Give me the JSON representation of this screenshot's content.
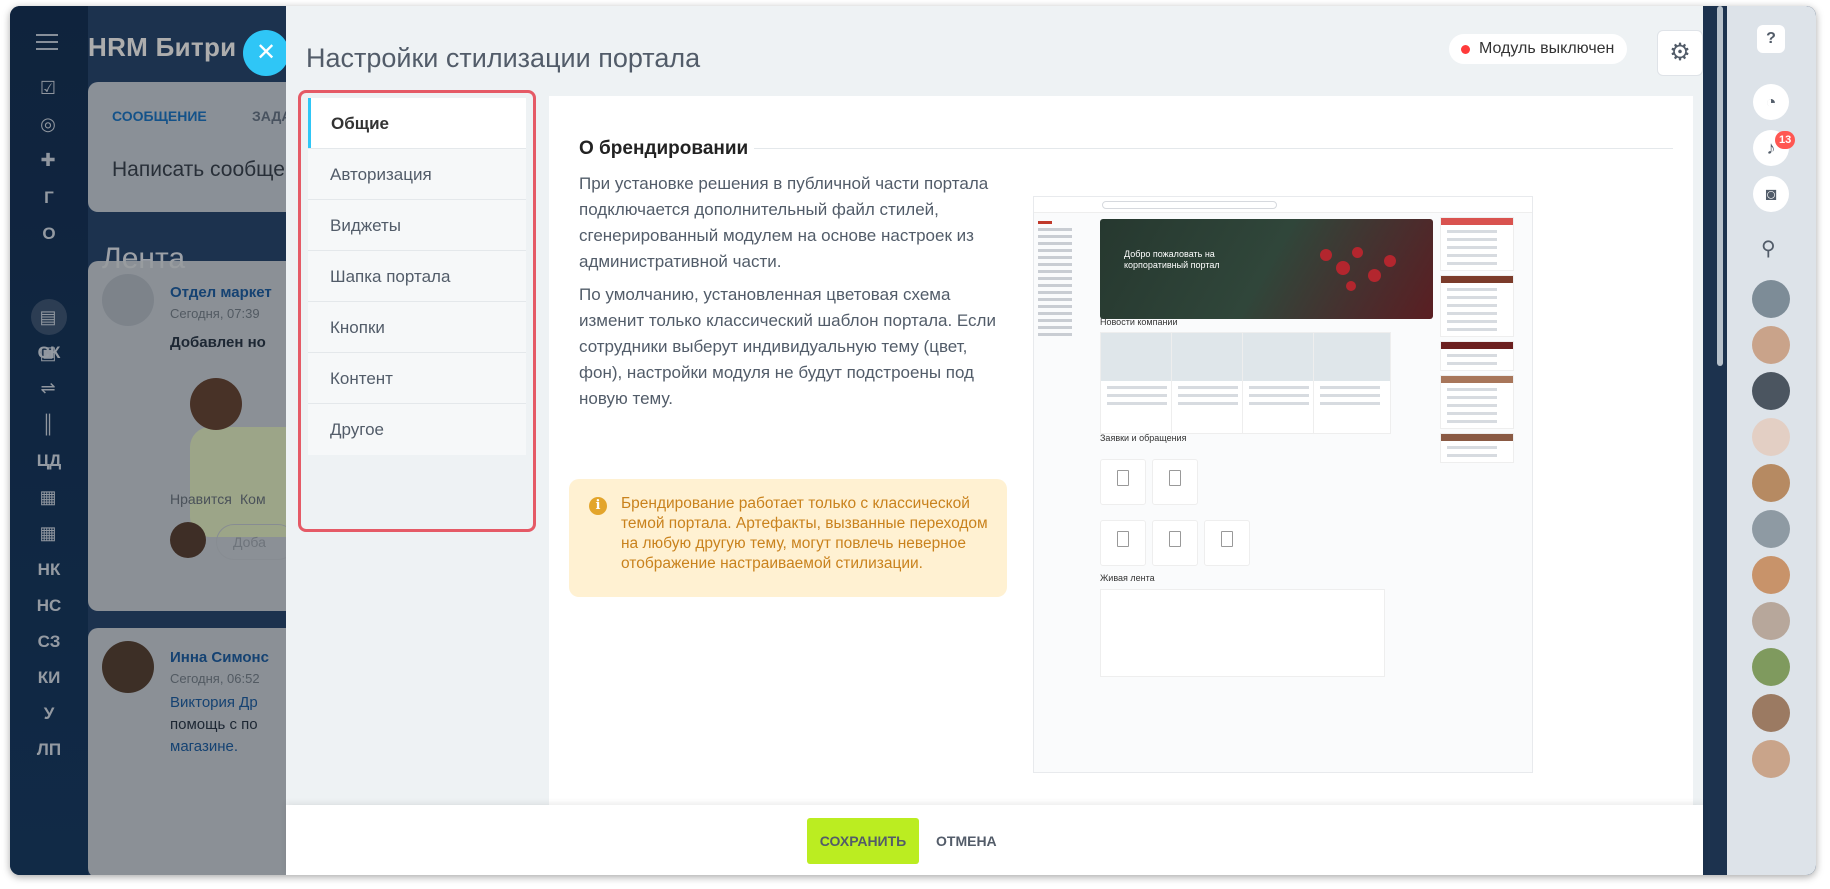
{
  "app": {
    "title": "HRM Битри"
  },
  "left_rail": {
    "items": [
      "Г",
      "О",
      "СК",
      "ЦД",
      "НК",
      "НС",
      "СЗ",
      "КИ",
      "У",
      "ЛП"
    ]
  },
  "background": {
    "tabs": [
      "СООБЩЕНИЕ",
      "ЗАДА"
    ],
    "write_placeholder": "Написать сообщен",
    "feed_title": "Лента",
    "post1": {
      "author": "Отдел маркет",
      "time": "Сегодня, 07:39",
      "text": "Добавлен но",
      "likes": "Нравится",
      "comment": "Ком",
      "comment_input": "Доба"
    },
    "post2": {
      "author": "Инна Симонс",
      "time": "Сегодня, 06:52",
      "line1": "Виктория Др",
      "line2": "помощь с по",
      "line3": "магазине."
    }
  },
  "slider": {
    "title": "Настройки стилизации портала",
    "status_label": "Модуль выключен",
    "status_color": "#ff3b3b"
  },
  "nav": {
    "items": [
      {
        "label": "Общие",
        "active": true
      },
      {
        "label": "Авторизация"
      },
      {
        "label": "Виджеты"
      },
      {
        "label": "Шапка портала"
      },
      {
        "label": "Кнопки"
      },
      {
        "label": "Контент"
      },
      {
        "label": "Другое"
      }
    ]
  },
  "content": {
    "section_title": "О брендировании",
    "paragraph1": "При установке решения в публичной части портала подключается дополнительный файл стилей, сгенерированный модулем на основе настроек из административной части.",
    "paragraph2": "По умолчанию, установленная цветовая схема изменит только классический шаблон портала. Если сотрудники выберут индивидуальную тему (цвет, фон), настройки модуля не будут подстроены под новую тему.",
    "alert_text": "Брендирование работает только с классической темой портала. Артефакты, вызванные переходом на любую другую тему, могут повлечь неверное отображение настраиваемой стилизации."
  },
  "preview": {
    "hero_text": "Добро пожаловать на корпоративный портал",
    "news_heading": "Новости компании",
    "requests_heading": "Заявки и обращения",
    "feed_heading": "Живая лента"
  },
  "footer": {
    "save_label": "СОХРАНИТЬ",
    "cancel_label": "ОТМЕНА"
  },
  "right_rail": {
    "help": "?",
    "notifications_count": "13"
  },
  "colors": {
    "accent": "#2fc6f6",
    "save": "#bbed21",
    "highlight_border": "#e55a66",
    "alert_bg": "#fff1d2",
    "alert_text": "#c9821d"
  }
}
